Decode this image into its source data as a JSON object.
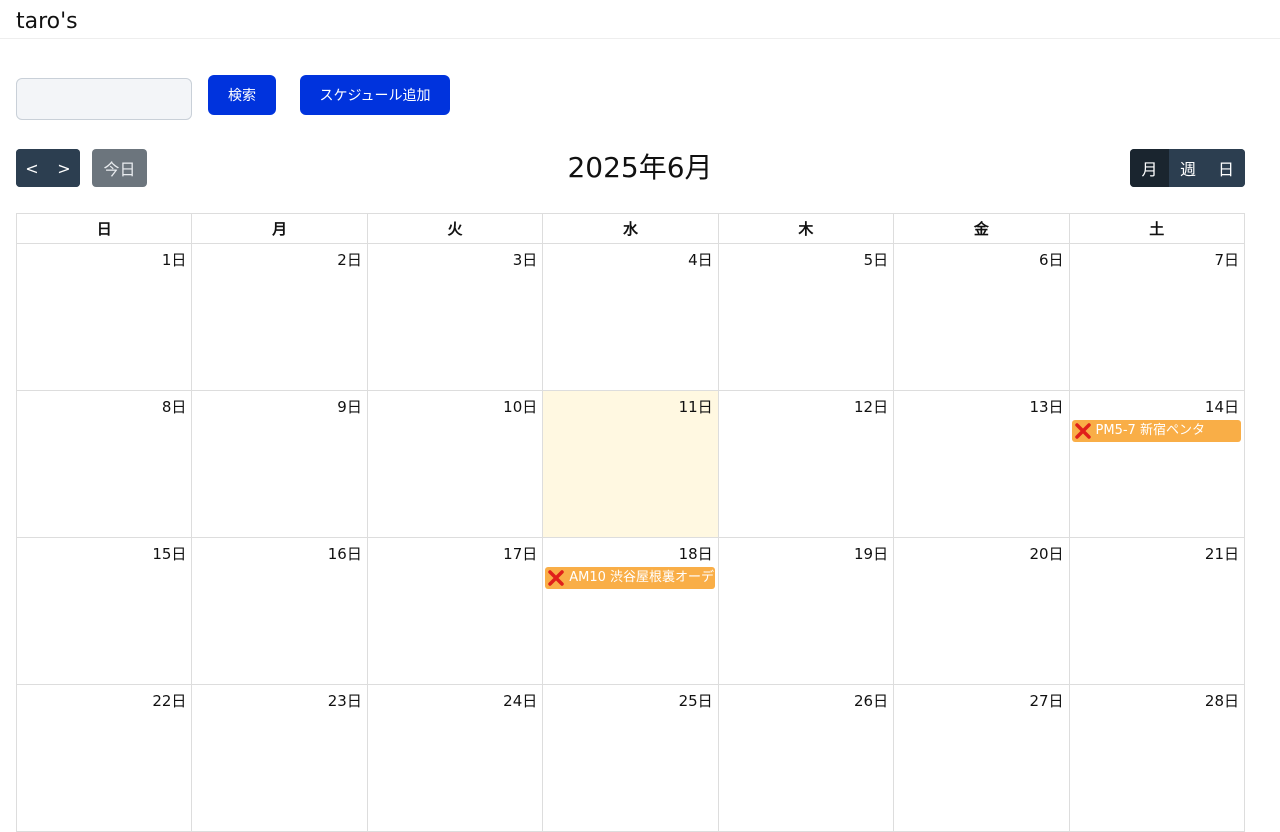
{
  "header": {
    "brand": "taro's"
  },
  "search": {
    "value": "",
    "placeholder": ""
  },
  "toolbar": {
    "search_label": "検索",
    "add_label": "スケジュール追加"
  },
  "nav": {
    "prev_label": "<",
    "next_label": ">",
    "today_label": "今日"
  },
  "calendar": {
    "title": "2025年6月",
    "views": [
      "月",
      "週",
      "日"
    ],
    "active_view": "月",
    "weekdays": [
      "日",
      "月",
      "火",
      "水",
      "木",
      "金",
      "土"
    ],
    "weeks": [
      [
        {
          "day": "1日"
        },
        {
          "day": "2日"
        },
        {
          "day": "3日"
        },
        {
          "day": "4日"
        },
        {
          "day": "5日"
        },
        {
          "day": "6日"
        },
        {
          "day": "7日"
        }
      ],
      [
        {
          "day": "8日"
        },
        {
          "day": "9日"
        },
        {
          "day": "10日"
        },
        {
          "day": "11日",
          "today": true
        },
        {
          "day": "12日"
        },
        {
          "day": "13日"
        },
        {
          "day": "14日",
          "events": [
            {
              "title": "PM5-7 新宿ペンタ"
            }
          ]
        }
      ],
      [
        {
          "day": "15日"
        },
        {
          "day": "16日"
        },
        {
          "day": "17日"
        },
        {
          "day": "18日",
          "events": [
            {
              "title": "AM10 渋谷屋根裏オーデ"
            }
          ]
        },
        {
          "day": "19日"
        },
        {
          "day": "20日"
        },
        {
          "day": "21日"
        }
      ],
      [
        {
          "day": "22日"
        },
        {
          "day": "23日"
        },
        {
          "day": "24日"
        },
        {
          "day": "25日"
        },
        {
          "day": "26日"
        },
        {
          "day": "27日"
        },
        {
          "day": "28日"
        }
      ]
    ]
  },
  "colors": {
    "primary_button": "#0033dd",
    "nav_button": "#2c3e50",
    "today_button": "#6c757d",
    "today_cell": "#fff8e1",
    "event_bg": "#f9ae47",
    "event_icon": "#e0201b"
  },
  "icons": {
    "event_status": "cross-mark-icon"
  }
}
